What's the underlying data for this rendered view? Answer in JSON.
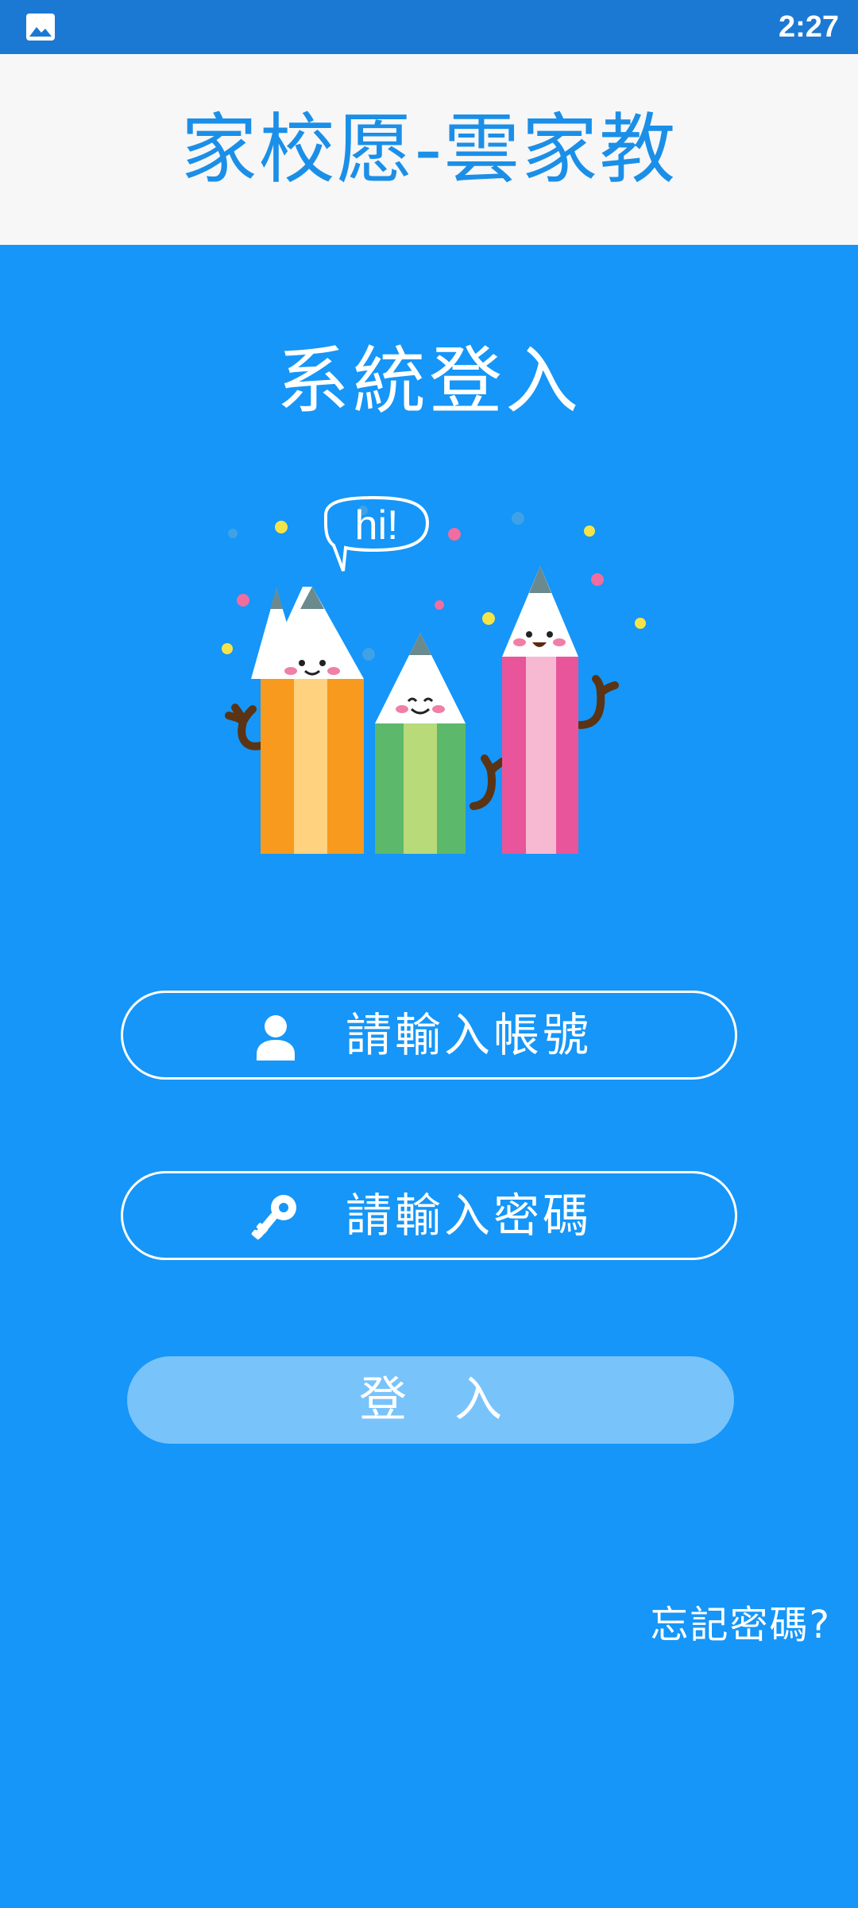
{
  "status_bar": {
    "time": "2:27",
    "notification_icon": "gallery-icon"
  },
  "header": {
    "title": "家校愿-雲家教"
  },
  "main": {
    "title": "系統登入",
    "illustration_text": "hi!",
    "username": {
      "placeholder": "請輸入帳號",
      "value": "",
      "icon": "user-icon"
    },
    "password": {
      "placeholder": "請輸入密碼",
      "value": "",
      "icon": "key-icon"
    },
    "login_label": "登入",
    "forgot_label": "忘記密碼?"
  },
  "colors": {
    "status_bar": "#1b79d4",
    "header_bg": "#f7f7f7",
    "title_blue": "#1b8fe8",
    "background": "#1596f8",
    "button_disabled": "#79c3fb"
  }
}
